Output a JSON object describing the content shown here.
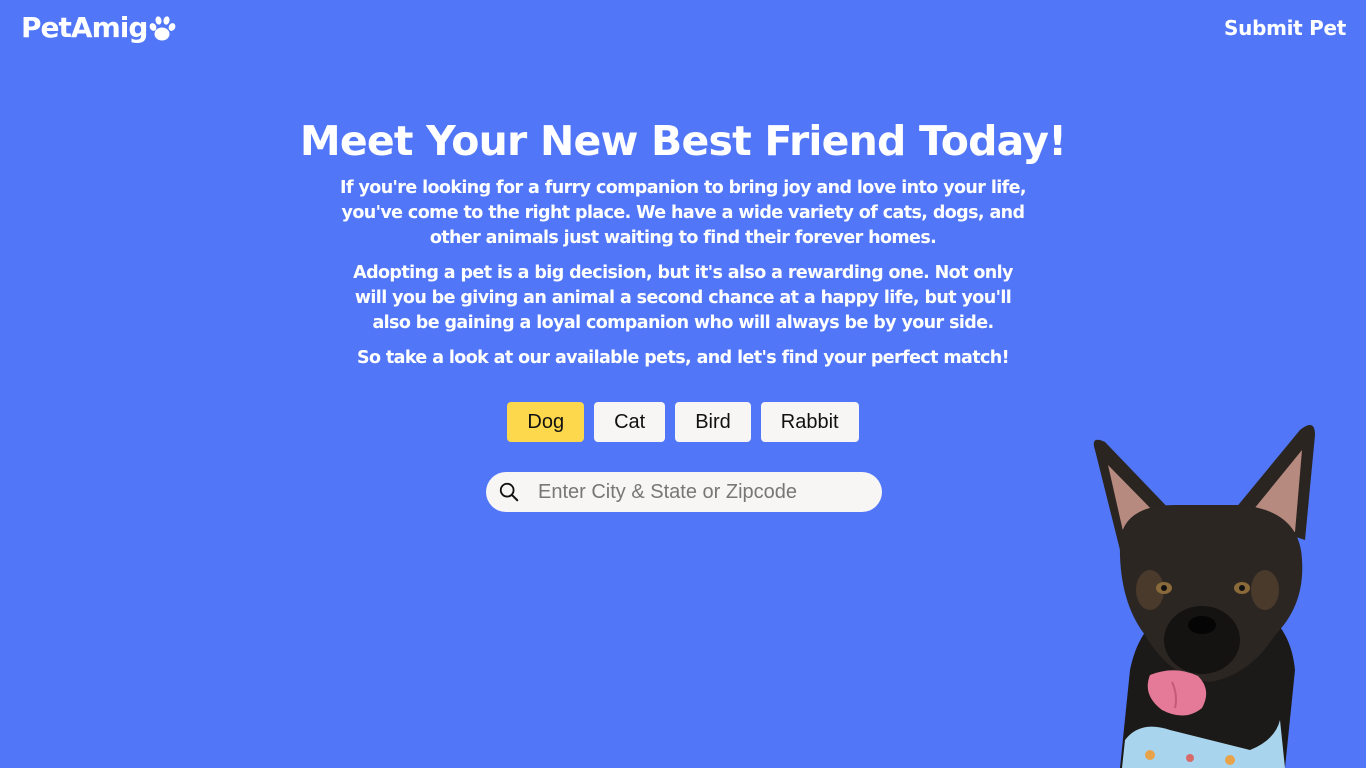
{
  "header": {
    "logo_text": "PetAmig",
    "logo_icon": "paw-icon",
    "submit_label": "Submit Pet"
  },
  "hero": {
    "title": "Meet Your New Best Friend Today!",
    "paragraph_1": "If you're looking for a furry companion to bring joy and love into your life, you've come to the right place. We have a wide variety of cats, dogs, and other animals just waiting to find their forever homes.",
    "paragraph_2": "Adopting a pet is a big decision, but it's also a rewarding one. Not only will you be giving an animal a second chance at a happy life, but you'll also be gaining a loyal companion who will always be by your side.",
    "paragraph_3": "So take a look at our available pets, and let's find your perfect match!"
  },
  "filters": {
    "selected": "Dog",
    "items": [
      {
        "label": "Dog"
      },
      {
        "label": "Cat"
      },
      {
        "label": "Bird"
      },
      {
        "label": "Rabbit"
      }
    ]
  },
  "search": {
    "icon": "search-icon",
    "placeholder": "Enter City & State or Zipcode",
    "value": ""
  },
  "colors": {
    "background": "#5177f8",
    "accent_selected": "#fdd74c",
    "button_background": "#f7f6f5",
    "text": "#ffffff"
  }
}
